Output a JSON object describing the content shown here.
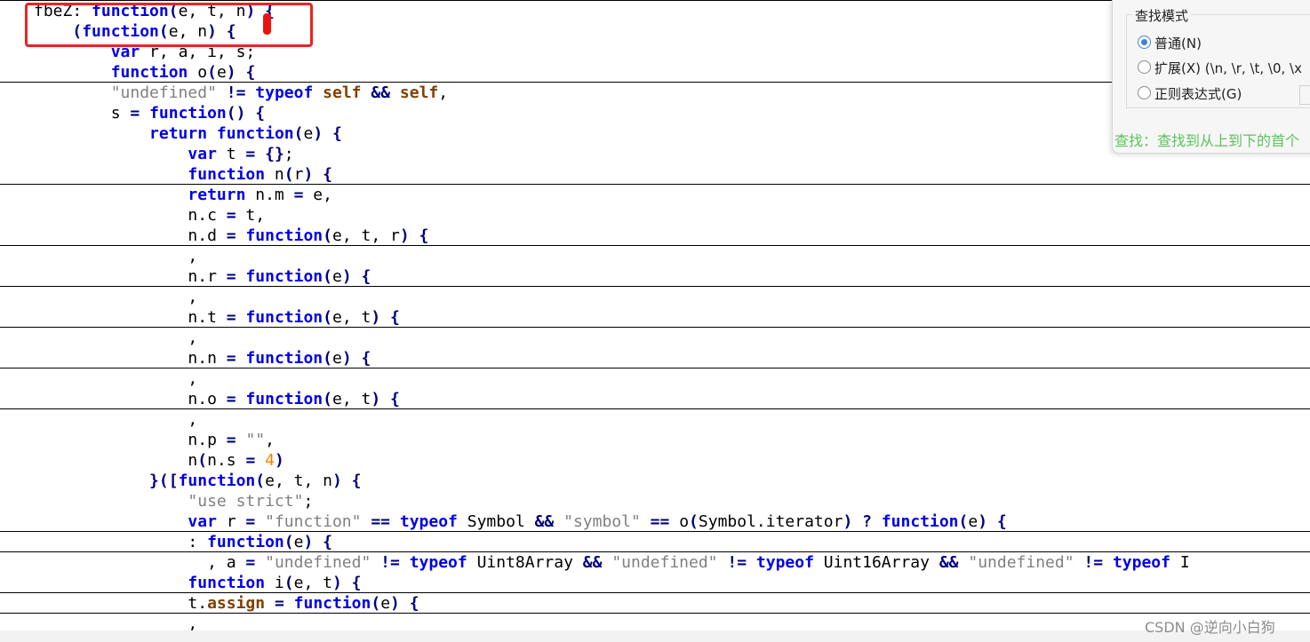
{
  "editor": {
    "lines": [
      "fbeZ: function(e, t, n) {",
      "    (function(e, n) {",
      "        var r, a, i, s;",
      "        function o(e) {",
      "        \"undefined\" != typeof self && self,",
      "        s = function() {",
      "            return function(e) {",
      "                var t = {};",
      "                function n(r) {",
      "                return n.m = e,",
      "                n.c = t,",
      "                n.d = function(e, t, r) {",
      "                ,",
      "                n.r = function(e) {",
      "                ,",
      "                n.t = function(e, t) {",
      "                ,",
      "                n.n = function(e) {",
      "                ,",
      "                n.o = function(e, t) {",
      "                ,",
      "                n.p = \"\",",
      "                n(n.s = 4)",
      "            }([function(e, t, n) {",
      "                \"use strict\";",
      "                var r = \"function\" == typeof Symbol && \"symbol\" == o(Symbol.iterator) ? function(e) {",
      "                : function(e) {",
      "                  , a = \"undefined\" != typeof Uint8Array && \"undefined\" != typeof Uint16Array && \"undefined\" != typeof I",
      "                function i(e, t) {",
      "                t.assign = function(e) {",
      "                ,"
    ]
  },
  "find_dialog": {
    "mode_title": "查找模式",
    "options": [
      {
        "label": "普通(N)",
        "checked": true
      },
      {
        "label": "扩展(X) (\\n, \\r, \\t, \\0, \\x",
        "checked": false
      },
      {
        "label": "正则表达式(G)",
        "checked": false
      }
    ],
    "status": "查找：查找到从上到下的首个"
  },
  "watermark": "CSDN @逆向小白狗",
  "colors": {
    "keyword": "#0000e6",
    "operator": "#000080",
    "string": "#808080",
    "number": "#ff8000",
    "property": "#804000",
    "annotation": "#ee2222",
    "status_text": "#5cc35c",
    "radio_checked": "#3b82d6"
  }
}
